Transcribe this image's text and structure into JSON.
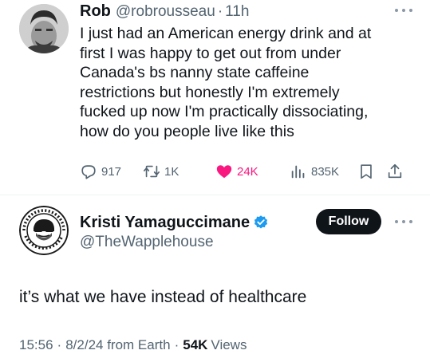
{
  "tweet": {
    "author_name": "Rob",
    "author_handle": "@robrousseau",
    "dot": "·",
    "time": "11h",
    "body_lines": [
      "I just had an American energy drink and at",
      "first I was happy to get out from under",
      "Canada's bs nanny state caffeine",
      "restrictions but honestly I'm extremely",
      "fucked up now I'm practically dissociating,",
      "how do you people live like this"
    ],
    "actions": {
      "replies": "917",
      "reposts": "1K",
      "likes": "24K",
      "views": "835K"
    },
    "icons": [
      "more-icon",
      "reply-icon",
      "repost-icon",
      "heart-icon",
      "views-icon",
      "bookmark-icon",
      "share-icon"
    ],
    "like_color": "#f91880"
  },
  "reply": {
    "author_name": "Kristi Yamaguccimane",
    "author_handle": "@TheWapplehouse",
    "verified_color": "#1d9bf0",
    "follow_label": "Follow",
    "body": "it’s what we have instead of healthcare",
    "meta": {
      "time": "15:56",
      "dot1": "·",
      "date": "8/2/24 from Earth",
      "dot2": "·",
      "views_count": "54K",
      "views_label": "Views"
    },
    "icons": [
      "more-icon",
      "verified-badge-icon"
    ]
  }
}
